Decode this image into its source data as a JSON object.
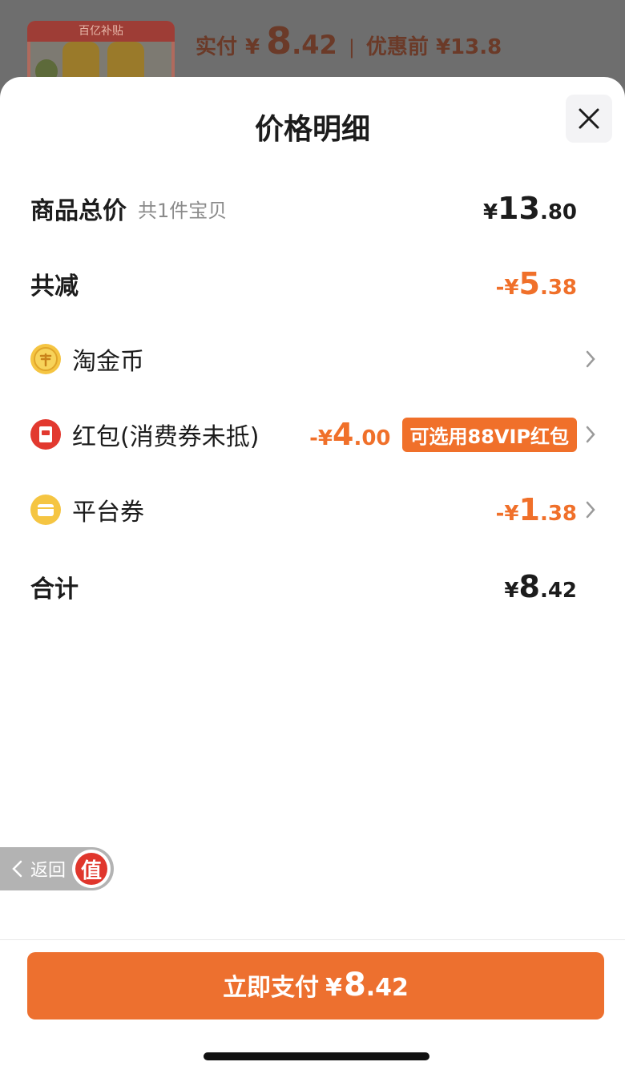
{
  "background": {
    "thumb_banner": "百亿补贴",
    "paid_label": "实付",
    "paid_currency": "¥",
    "paid_int": "8",
    "paid_dec": ".42",
    "separator": "|",
    "orig_label": "优惠前 ¥13.8"
  },
  "sheet": {
    "title": "价格明细",
    "close_icon": "close-icon"
  },
  "rows": {
    "total": {
      "label": "商品总价",
      "sub": "共1件宝贝",
      "currency": "¥",
      "int": "13",
      "dec": ".80"
    },
    "reduction": {
      "label": "共减",
      "currency": "-¥",
      "int": "5",
      "dec": ".38"
    },
    "coins": {
      "label": "淘金币",
      "icon": "coin-icon"
    },
    "redpacket": {
      "label": "红包(消费券未抵)",
      "icon": "red-packet-icon",
      "currency": "-¥",
      "int": "4",
      "dec": ".00",
      "tag": "可选用88VIP红包"
    },
    "platform": {
      "label": "平台券",
      "icon": "coupon-icon",
      "currency": "-¥",
      "int": "1",
      "dec": ".38"
    },
    "sum": {
      "label": "合计",
      "currency": "¥",
      "int": "8",
      "dec": ".42"
    }
  },
  "back": {
    "label": "返回",
    "badge": "值"
  },
  "pay": {
    "label": "立即支付",
    "currency": "¥",
    "int": "8",
    "dec": ".42"
  },
  "colors": {
    "accent": "#ed702f",
    "orange_text": "#f0702a"
  }
}
